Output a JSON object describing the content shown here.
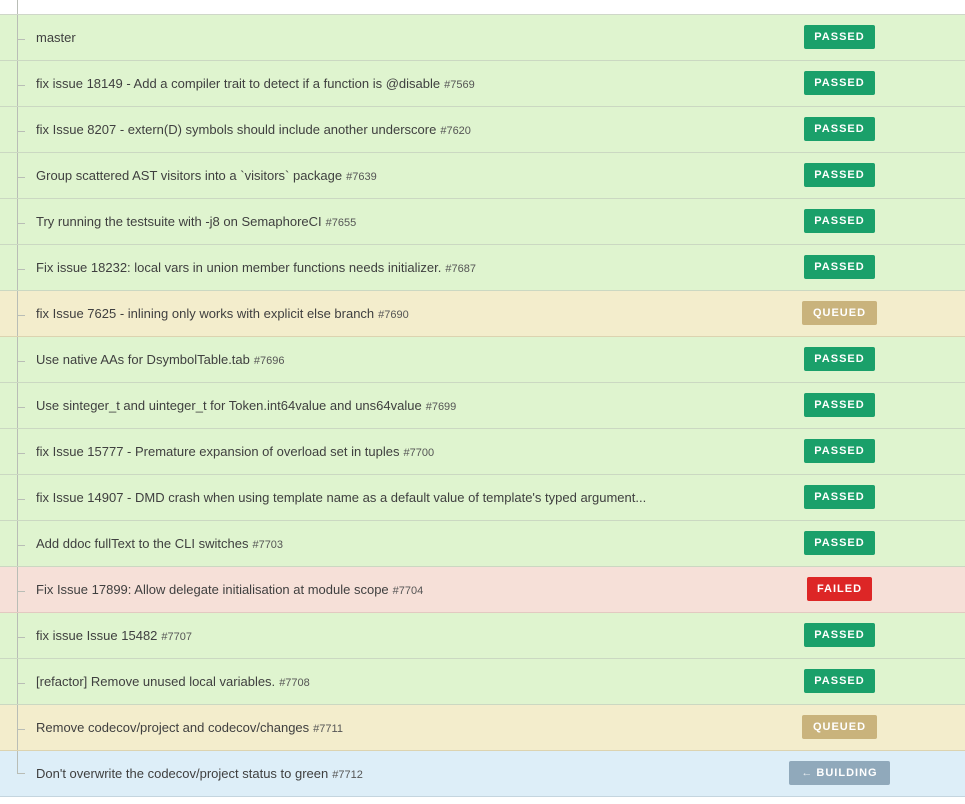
{
  "rows": [
    {
      "title": "master",
      "pr": "",
      "status": "passed",
      "badge": "PASSED"
    },
    {
      "title": "fix issue 18149 - Add a compiler trait to detect if a function is @disable",
      "pr": "#7569",
      "status": "passed",
      "badge": "PASSED"
    },
    {
      "title": "fix Issue 8207 - extern(D) symbols should include another underscore",
      "pr": "#7620",
      "status": "passed",
      "badge": "PASSED"
    },
    {
      "title": "Group scattered AST visitors into a `visitors` package",
      "pr": "#7639",
      "status": "passed",
      "badge": "PASSED"
    },
    {
      "title": "Try running the testsuite with -j8 on SemaphoreCI",
      "pr": "#7655",
      "status": "passed",
      "badge": "PASSED"
    },
    {
      "title": "Fix issue 18232: local vars in union member functions needs initializer.",
      "pr": "#7687",
      "status": "passed",
      "badge": "PASSED"
    },
    {
      "title": "fix Issue 7625 - inlining only works with explicit else branch",
      "pr": "#7690",
      "status": "queued",
      "badge": "QUEUED"
    },
    {
      "title": "Use native AAs for DsymbolTable.tab",
      "pr": "#7696",
      "status": "passed",
      "badge": "PASSED"
    },
    {
      "title": "Use sinteger_t and uinteger_t for Token.int64value and uns64value",
      "pr": "#7699",
      "status": "passed",
      "badge": "PASSED"
    },
    {
      "title": "fix Issue 15777 - Premature expansion of overload set in tuples",
      "pr": "#7700",
      "status": "passed",
      "badge": "PASSED"
    },
    {
      "title": "fix Issue 14907 - DMD crash when using template name as a default value of template's typed argument...",
      "pr": "",
      "status": "passed",
      "badge": "PASSED"
    },
    {
      "title": "Add ddoc fullText to the CLI switches",
      "pr": "#7703",
      "status": "passed",
      "badge": "PASSED"
    },
    {
      "title": "Fix Issue 17899: Allow delegate initialisation at module scope",
      "pr": "#7704",
      "status": "failed",
      "badge": "FAILED"
    },
    {
      "title": "fix issue Issue 15482",
      "pr": "#7707",
      "status": "passed",
      "badge": "PASSED"
    },
    {
      "title": "[refactor] Remove unused local variables.",
      "pr": "#7708",
      "status": "passed",
      "badge": "PASSED"
    },
    {
      "title": "Remove codecov/project and codecov/changes",
      "pr": "#7711",
      "status": "queued",
      "badge": "QUEUED"
    },
    {
      "title": "Don't overwrite the codecov/project status to green",
      "pr": "#7712",
      "status": "building",
      "badge": "BUILDING",
      "badge_icon": "←"
    }
  ]
}
